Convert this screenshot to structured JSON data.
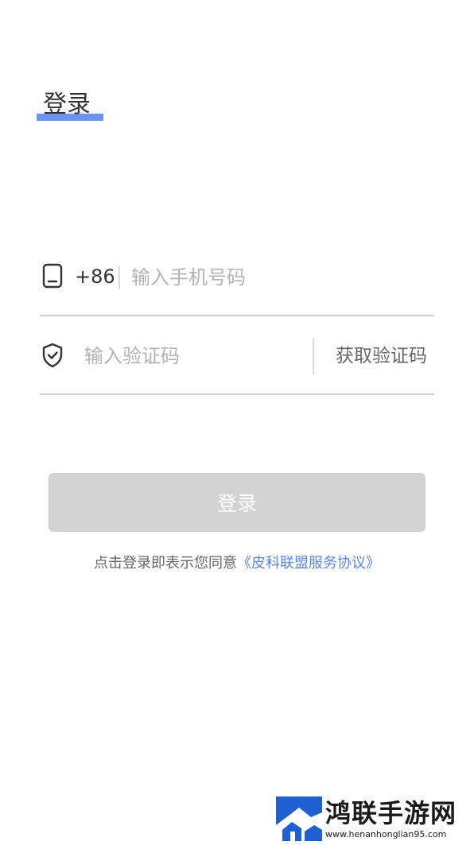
{
  "header": {
    "title": "登录",
    "accent_color": "#6b93f2"
  },
  "form": {
    "phone": {
      "icon": "phone-icon",
      "country_code": "+86",
      "placeholder": "输入手机号码",
      "value": ""
    },
    "code": {
      "icon": "shield-check-icon",
      "placeholder": "输入验证码",
      "value": "",
      "get_code_label": "获取验证码"
    },
    "submit_label": "登录",
    "submit_color": "#d3d3d3"
  },
  "agreement": {
    "prefix": "点击登录即表示您同意",
    "link_text": "《皮科联盟服务协议》",
    "link_color": "#5b86e5"
  },
  "watermark": {
    "name": "鸿联手游网",
    "url": "www.henanhonglian95.com",
    "logo_icon": "house-logo-icon"
  }
}
